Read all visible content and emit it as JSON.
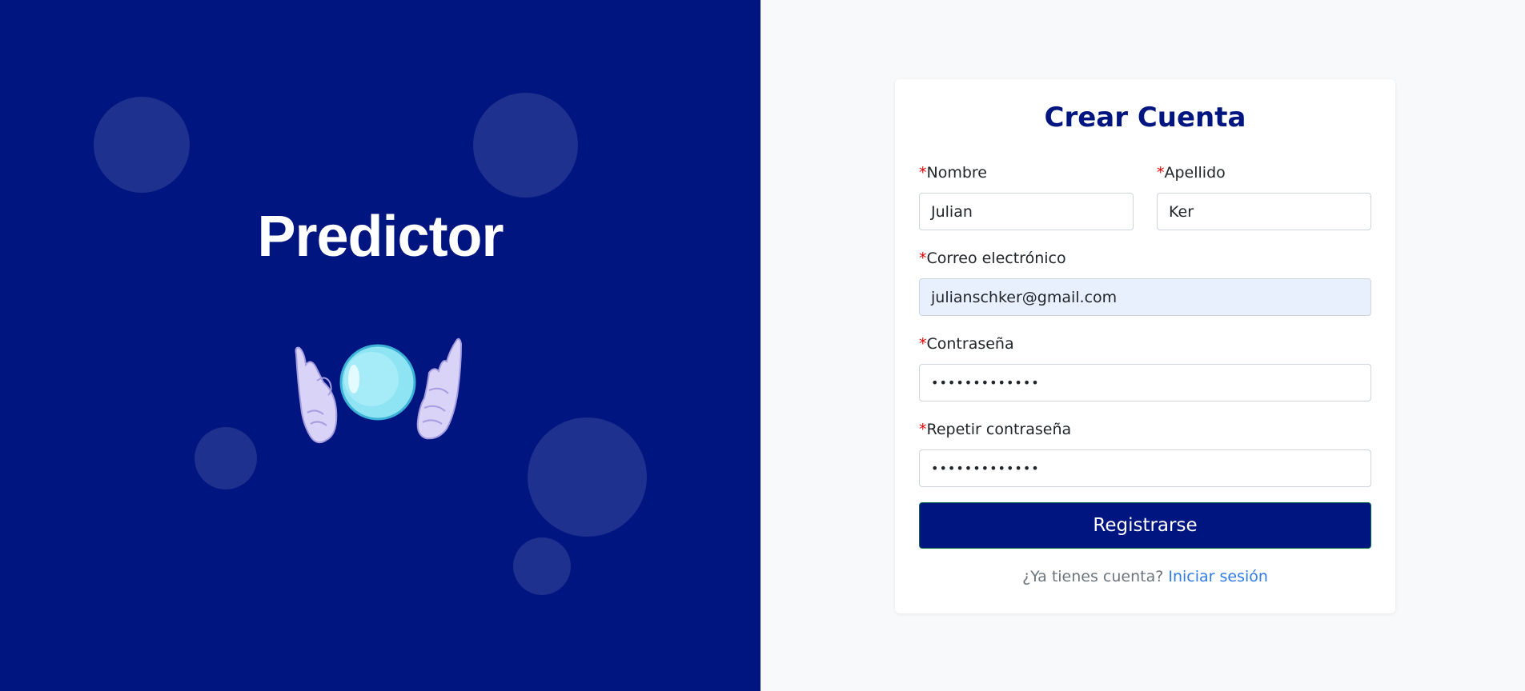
{
  "brand": {
    "name": "Predictor",
    "colors": {
      "panel": "#00157f",
      "bubble": "rgba(255,255,255,0.12)"
    },
    "illustration": "crystal-ball-hands"
  },
  "form": {
    "title": "Crear Cuenta",
    "required_marker": "*",
    "fields": {
      "nombre": {
        "label": "Nombre",
        "value": "Julian"
      },
      "apellido": {
        "label": "Apellido",
        "value": "Ker"
      },
      "correo": {
        "label": "Correo electrónico",
        "value": "julianschker@gmail.com"
      },
      "contrasena": {
        "label": "Contraseña",
        "value": "•••••••••••••"
      },
      "repetir": {
        "label": "Repetir contraseña",
        "value": "•••••••••••••"
      }
    },
    "submit_label": "Registrarse",
    "login_prompt": "¿Ya tienes cuenta?",
    "login_link": "Iniciar sesión",
    "colors": {
      "accent": "#00157f",
      "link": "#2f7ae5",
      "required": "#e00000",
      "autofill": "#e8f0fe"
    }
  }
}
